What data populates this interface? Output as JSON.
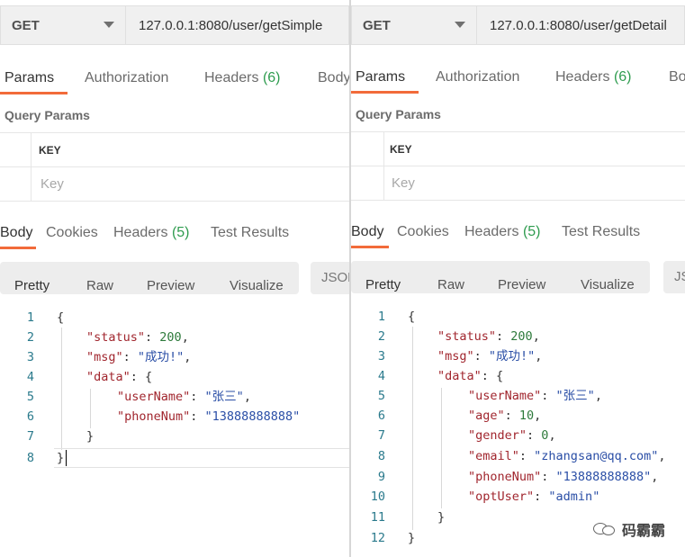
{
  "left": {
    "method": "GET",
    "url": "127.0.0.1:8080/user/getSimple",
    "request_tabs": [
      "Params",
      "Authorization",
      "Headers",
      "Body"
    ],
    "request_headers_count": "(6)",
    "query_params_title": "Query Params",
    "key_header": "KEY",
    "key_placeholder": "Key",
    "response_tabs": [
      "Body",
      "Cookies",
      "Headers",
      "Test Results"
    ],
    "response_headers_count": "(5)",
    "view_buttons": [
      "Pretty",
      "Raw",
      "Preview",
      "Visualize"
    ],
    "format_select": "JSON",
    "line_numbers": [
      "1",
      "2",
      "3",
      "4",
      "5",
      "6",
      "7",
      "8"
    ],
    "code": {
      "open": "{",
      "status_key": "\"status\"",
      "status_val": "200",
      "msg_key": "\"msg\"",
      "msg_val": "\"成功!\"",
      "data_key": "\"data\"",
      "userName_key": "\"userName\"",
      "userName_val": "\"张三\"",
      "phoneNum_key": "\"phoneNum\"",
      "phoneNum_val": "\"13888888888\"",
      "inner_close": "}",
      "close": "}"
    }
  },
  "right": {
    "method": "GET",
    "url": "127.0.0.1:8080/user/getDetail",
    "request_tabs": [
      "Params",
      "Authorization",
      "Headers",
      "Body"
    ],
    "request_headers_count": "(6)",
    "query_params_title": "Query Params",
    "key_header": "KEY",
    "key_placeholder": "Key",
    "response_tabs": [
      "Body",
      "Cookies",
      "Headers",
      "Test Results"
    ],
    "response_headers_count": "(5)",
    "view_buttons": [
      "Pretty",
      "Raw",
      "Preview",
      "Visualize"
    ],
    "format_select": "JSON",
    "line_numbers": [
      "1",
      "2",
      "3",
      "4",
      "5",
      "6",
      "7",
      "8",
      "9",
      "10",
      "11",
      "12"
    ],
    "code": {
      "open": "{",
      "status_key": "\"status\"",
      "status_val": "200",
      "msg_key": "\"msg\"",
      "msg_val": "\"成功!\"",
      "data_key": "\"data\"",
      "userName_key": "\"userName\"",
      "userName_val": "\"张三\"",
      "age_key": "\"age\"",
      "age_val": "10",
      "gender_key": "\"gender\"",
      "gender_val": "0",
      "email_key": "\"email\"",
      "email_val": "\"zhangsan@qq.com\"",
      "phoneNum_key": "\"phoneNum\"",
      "phoneNum_val": "\"13888888888\"",
      "optUser_key": "\"optUser\"",
      "optUser_val": "\"admin\"",
      "inner_close": "}",
      "close": "}"
    }
  },
  "watermark": "码霸霸",
  "colors": {
    "accent": "#f26b3a",
    "count_green": "#2f9c4f",
    "json_key": "#a1262e",
    "json_string": "#2a4ea6",
    "json_number": "#2d7a3b"
  }
}
